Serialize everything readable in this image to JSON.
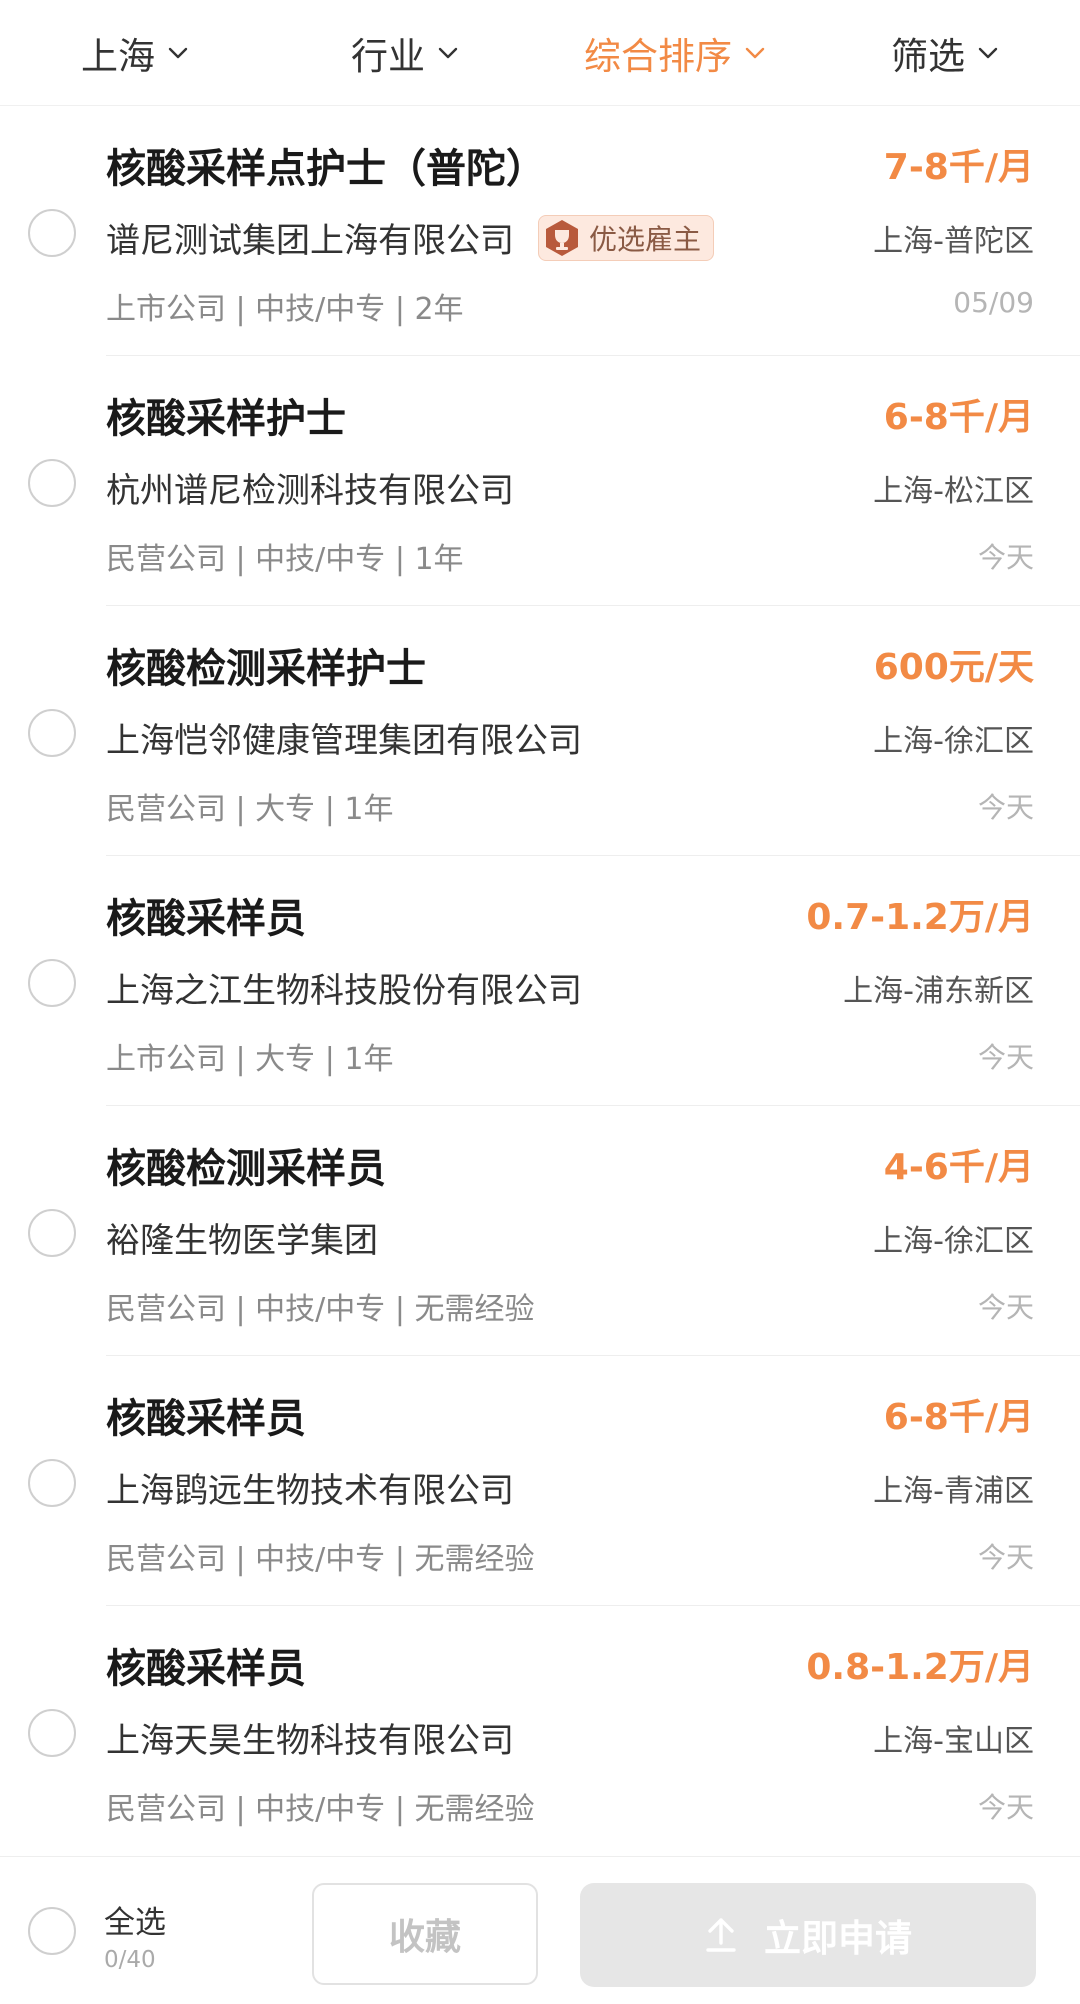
{
  "filters": [
    {
      "label": "上海",
      "active": false
    },
    {
      "label": "行业",
      "active": false
    },
    {
      "label": "综合排序",
      "active": true
    },
    {
      "label": "筛选",
      "active": false
    }
  ],
  "colors": {
    "accent": "#f28a45",
    "text_primary": "#1a1a1a",
    "text_secondary": "#8a8a8a",
    "disabled_button": "#e6e6e6"
  },
  "jobs": [
    {
      "title": "核酸采样点护士（普陀）",
      "salary": "7-8千/月",
      "company": "谱尼测试集团上海有限公司",
      "badge": "优选雇主",
      "location": "上海-普陀区",
      "meta": "上市公司 | 中技/中专 | 2年",
      "date": "05/09"
    },
    {
      "title": "核酸采样护士",
      "salary": "6-8千/月",
      "company": "杭州谱尼检测科技有限公司",
      "badge": "",
      "location": "上海-松江区",
      "meta": "民营公司 | 中技/中专 | 1年",
      "date": "今天"
    },
    {
      "title": "核酸检测采样护士",
      "salary": "600元/天",
      "company": "上海恺邻健康管理集团有限公司",
      "badge": "",
      "location": "上海-徐汇区",
      "meta": "民营公司 | 大专 | 1年",
      "date": "今天"
    },
    {
      "title": "核酸采样员",
      "salary": "0.7-1.2万/月",
      "company": "上海之江生物科技股份有限公司",
      "badge": "",
      "location": "上海-浦东新区",
      "meta": "上市公司 | 大专 | 1年",
      "date": "今天"
    },
    {
      "title": "核酸检测采样员",
      "salary": "4-6千/月",
      "company": "裕隆生物医学集团",
      "badge": "",
      "location": "上海-徐汇区",
      "meta": "民营公司 | 中技/中专 | 无需经验",
      "date": "今天"
    },
    {
      "title": "核酸采样员",
      "salary": "6-8千/月",
      "company": "上海鹍远生物技术有限公司",
      "badge": "",
      "location": "上海-青浦区",
      "meta": "民营公司 | 中技/中专 | 无需经验",
      "date": "今天"
    },
    {
      "title": "核酸采样员",
      "salary": "0.8-1.2万/月",
      "company": "上海天昊生物科技有限公司",
      "badge": "",
      "location": "上海-宝山区",
      "meta": "民营公司 | 中技/中专 | 无需经验",
      "date": "今天"
    }
  ],
  "bottom_bar": {
    "select_all_label": "全选",
    "select_count": "0/40",
    "collect_label": "收藏",
    "apply_label": "立即申请"
  }
}
